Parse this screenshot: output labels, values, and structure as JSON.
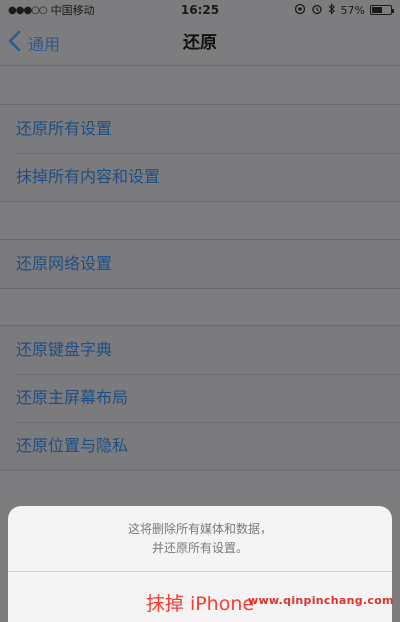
{
  "status_bar": {
    "signal": "●●●○○",
    "carrier": "中国移动",
    "time": "16:25",
    "battery_text": "57%",
    "battery_level": 0.57
  },
  "nav": {
    "back_label": "通用",
    "title": "还原"
  },
  "groups": [
    {
      "items": [
        "还原所有设置",
        "抹掉所有内容和设置"
      ]
    },
    {
      "items": [
        "还原网络设置"
      ]
    },
    {
      "items": [
        "还原键盘字典",
        "还原主屏幕布局",
        "还原位置与隐私"
      ]
    }
  ],
  "action_sheet": {
    "message_line1": "这将删除所有媒体和数据，",
    "message_line2": "并还原所有设置。",
    "button_label": "抹掉 iPhone"
  },
  "watermark": "www.qinpinchang.com",
  "colors": {
    "link": "#1f4e85",
    "destructive": "#ff3b30",
    "dim_background": "#7d7d7f"
  }
}
